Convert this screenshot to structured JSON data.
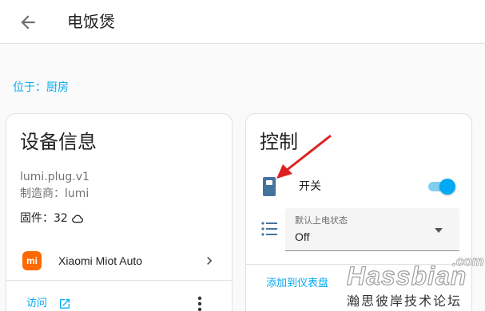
{
  "header": {
    "title": "电饭煲",
    "back_icon": "arrow-left-icon"
  },
  "area": {
    "link_text": "位于：厨房"
  },
  "device_info": {
    "title": "设备信息",
    "model": "lumi.plug.v1",
    "manufacturer": "制造商：lumi",
    "firmware": "固件：32",
    "firmware_icon": "cloud-icon",
    "integration": {
      "name": "Xiaomi Miot Auto",
      "logo_text": "mi",
      "logo_color": "#ff6900"
    },
    "visit_label": "访问"
  },
  "controls": {
    "title": "控制",
    "switch": {
      "label": "开关",
      "icon": "power-socket-icon",
      "state": "on"
    },
    "select": {
      "label": "默认上电状态",
      "value": "Off",
      "icon": "format-list-icon"
    },
    "add_to_dashboard": "添加到仪表盘"
  },
  "watermark": {
    "brand": "Hassbian",
    "suffix": ".com",
    "slogan": "瀚思彼岸技术论坛"
  },
  "colors": {
    "accent": "#03a9f4",
    "annotation_arrow": "#e02020",
    "toggle_track": "#81cfee"
  }
}
